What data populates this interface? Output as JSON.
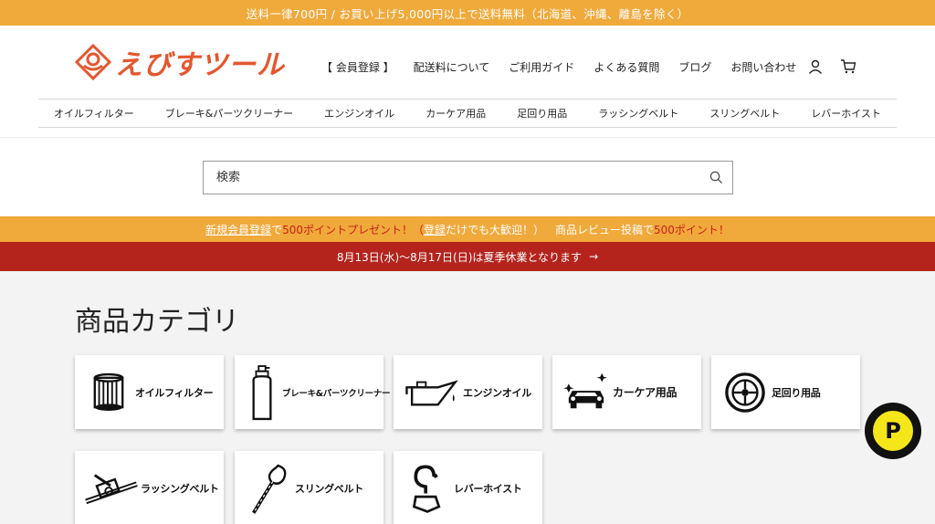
{
  "announcement": "送料一律700円 / お買い上げ5,000円以上で送料無料（北海道、沖縄、離島を除く）",
  "logo": {
    "text": "えびすツール"
  },
  "nav": [
    {
      "label": "【 会員登録 】"
    },
    {
      "label": "配送料について"
    },
    {
      "label": "ご利用ガイド"
    },
    {
      "label": "よくある質問"
    },
    {
      "label": "ブログ"
    },
    {
      "label": "お問い合わせ"
    }
  ],
  "category_nav": [
    {
      "label": "オイルフィルター"
    },
    {
      "label": "ブレーキ&パーツクリーナー"
    },
    {
      "label": "エンジンオイル"
    },
    {
      "label": "カーケア用品"
    },
    {
      "label": "足回り用品"
    },
    {
      "label": "ラッシングベルト"
    },
    {
      "label": "スリングベルト"
    },
    {
      "label": "レバーホイスト"
    }
  ],
  "search": {
    "placeholder": "検索"
  },
  "promo": {
    "p1": "新規会員登録",
    "p2": "で",
    "p3": "500ポイントプレゼント！（",
    "p4": "登録",
    "p5": "だけでも大歓迎！）",
    "p6": "　商品レビュー投稿で",
    "p7": "500ポイント！"
  },
  "notice": {
    "text": "8月13日(水)〜8月17日(日)は夏季休業となります",
    "arrow": "→"
  },
  "section": {
    "title": "商品カテゴリ"
  },
  "categories": [
    {
      "label": "オイルフィルター",
      "icon": "oil-filter-icon"
    },
    {
      "label": "ブレーキ&パーツクリーナー",
      "icon": "spray-can-icon"
    },
    {
      "label": "エンジンオイル",
      "icon": "oil-can-icon"
    },
    {
      "label": "カーケア用品",
      "icon": "car-icon"
    },
    {
      "label": "足回り用品",
      "icon": "tire-icon"
    },
    {
      "label": "ラッシングベルト",
      "icon": "ratchet-belt-icon"
    },
    {
      "label": "スリングベルト",
      "icon": "sling-icon"
    },
    {
      "label": "レバーホイスト",
      "icon": "hook-icon"
    }
  ],
  "points_badge": {
    "text": "P"
  },
  "colors": {
    "orange": "#f0a93b",
    "red": "#b4241d",
    "brand": "#e4572e",
    "yellow": "#f5e61a"
  }
}
